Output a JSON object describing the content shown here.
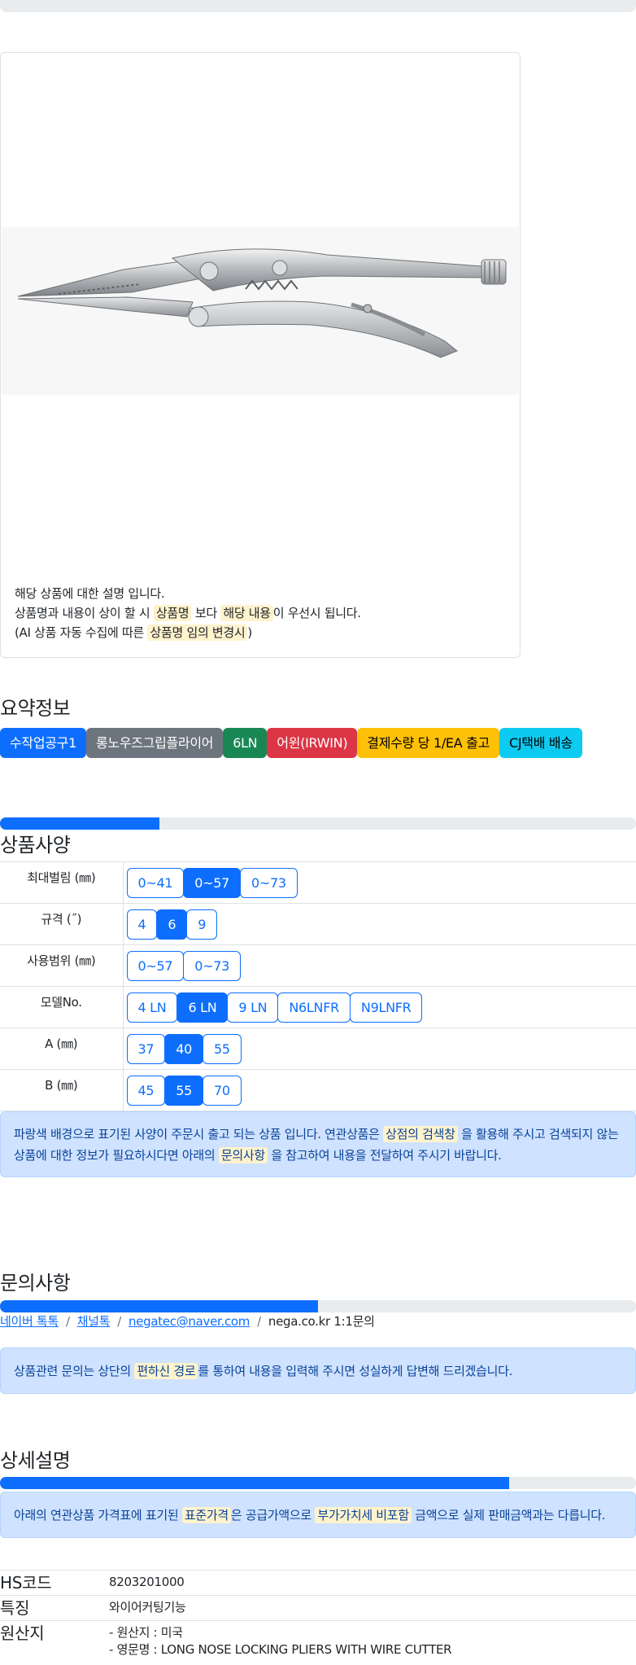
{
  "product_card": {
    "image_alt": "롱노우즈그립플라이어",
    "desc_line1": "해당 상품에 대한 설명 입니다.",
    "desc_line2_a": "상품명과 내용이 상이 할 시",
    "desc_line2_hl1": "상품명",
    "desc_line2_b": "보다",
    "desc_line2_hl2": "해당 내용",
    "desc_line2_c": "이 우선시 됩니다.",
    "desc_line3_a": "(AI 상품 자동 수집에 따른",
    "desc_line3_hl": "상품명 임의 변경시",
    "desc_line3_b": ")"
  },
  "summary": {
    "title": "요약정보",
    "badges": [
      {
        "label": "수작업공구1",
        "color": "#0d6efd",
        "text_color": "#ffffff"
      },
      {
        "label": "롱노우즈그립플라이어",
        "color": "#6c757d",
        "text_color": "#ffffff"
      },
      {
        "label": "6LN",
        "color": "#198754",
        "text_color": "#ffffff"
      },
      {
        "label": "어윈(IRWIN)",
        "color": "#dc3545",
        "text_color": "#ffffff"
      },
      {
        "label": "결제수량 당 1/EA 출고",
        "color": "#ffc107",
        "text_color": "#000000"
      },
      {
        "label": "CJ택배 배송",
        "color": "#0dcaf0",
        "text_color": "#000000"
      }
    ]
  },
  "spec": {
    "progress": 0.25,
    "title": "상품사양",
    "rows": [
      {
        "label": "최대벌림 (㎜)",
        "options": [
          "0~41",
          "0~57",
          "0~73"
        ],
        "active": 1
      },
      {
        "label": "규격 (˝)",
        "options": [
          "4",
          "6",
          "9"
        ],
        "active": 1
      },
      {
        "label": "사용범위 (㎜)",
        "options": [
          "0~57",
          "0~73"
        ],
        "active": -1
      },
      {
        "label": "모델No.",
        "options": [
          "4 LN",
          "6 LN",
          "9 LN",
          "N6LNFR",
          "N9LNFR"
        ],
        "active": 1
      },
      {
        "label": "A (㎜)",
        "options": [
          "37",
          "40",
          "55"
        ],
        "active": 1
      },
      {
        "label": "B (㎜)",
        "options": [
          "45",
          "55",
          "70"
        ],
        "active": 1
      }
    ],
    "notice_a": "파랑색 배경으로 표기된 사양이 주문시 출고 되는 상품 입니다. 연관상품은",
    "notice_hl1": "상점의 검색창",
    "notice_b": "을 활용해 주시고 검색되지 않는 상품에 대한 정보가 필요하시다면 아래의",
    "notice_hl2": "문의사항",
    "notice_c": "을 참고하여 내용을 전달하여 주시기 바랍니다."
  },
  "inquiry": {
    "title": "문의사항",
    "progress": 0.5,
    "links": [
      "네이버 톡톡",
      "채널톡",
      "negatec@naver.com"
    ],
    "last_crumb": "nega.co.kr 1:1문의",
    "sep": "/",
    "notice_a": "상품관련 문의는 상단의",
    "notice_hl": "편하신 경로",
    "notice_b": "를 통하여 내용을 입력해 주시면 성실하게 답변해 드리겠습니다."
  },
  "detail": {
    "title": "상세설명",
    "progress": 0.8,
    "notice_a": "아래의 연관상품 가격표에 표기된",
    "notice_hl1": "표준가격",
    "notice_b": "은 공급가액으로",
    "notice_hl2": "부가가치세 비포함",
    "notice_c": "금액으로 실제 판매금액과는 다릅니다.",
    "rows": [
      {
        "key": "HS코드",
        "values": [
          "8203201000"
        ]
      },
      {
        "key": "특징",
        "values": [
          "와이어커팅기능"
        ]
      },
      {
        "key": "원산지",
        "values": [
          "- 원산지 : 미국",
          "- 영문명 : LONG NOSE LOCKING PLIERS WITH WIRE CUTTER"
        ]
      }
    ]
  }
}
